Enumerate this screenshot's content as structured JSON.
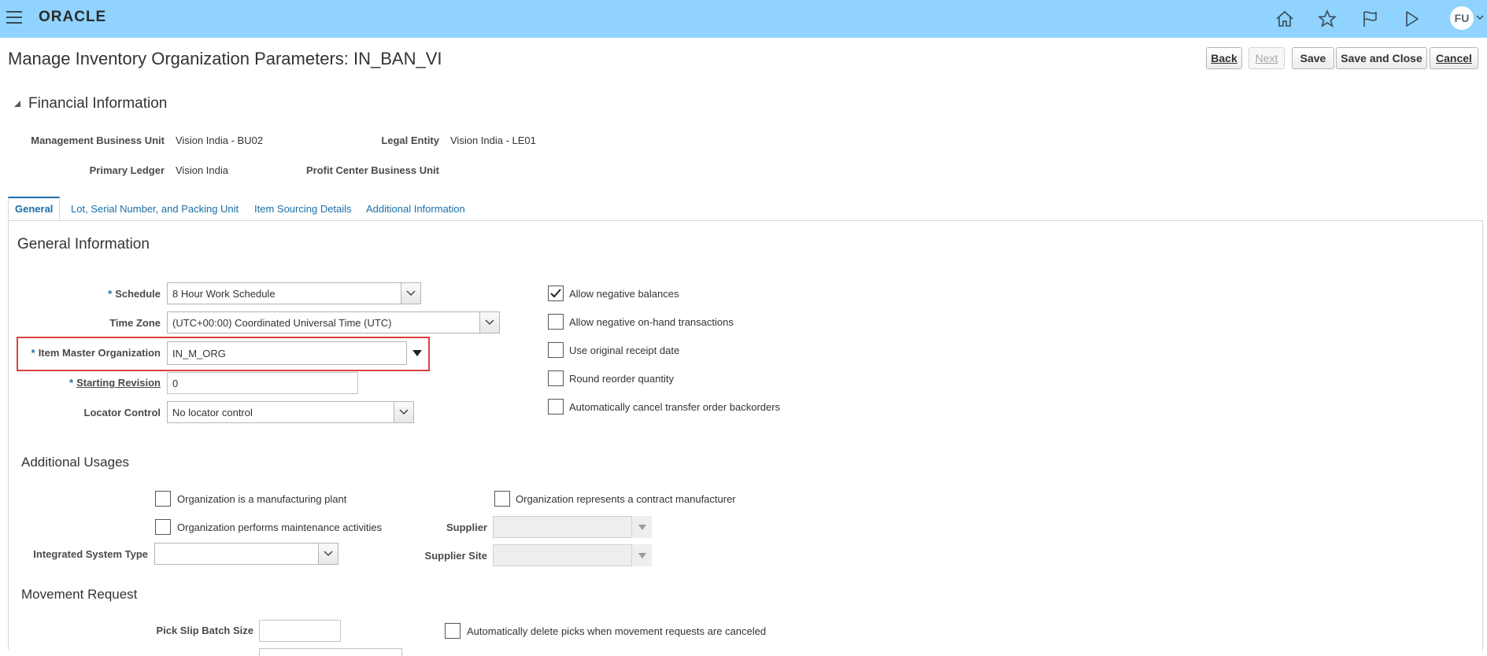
{
  "header": {
    "brand": "ORACLE",
    "avatar_initials": "FU",
    "icons": [
      "menu-icon",
      "home-icon",
      "star-icon",
      "flag-icon",
      "play-icon",
      "chevron-down-icon"
    ]
  },
  "page": {
    "title": "Manage Inventory Organization Parameters: IN_BAN_VI",
    "buttons": {
      "back": "Back",
      "next": "Next",
      "save": "Save",
      "save_close": "Save and Close",
      "cancel": "Cancel"
    }
  },
  "financial": {
    "title": "Financial Information",
    "mgmt_bu_label": "Management Business Unit",
    "mgmt_bu_value": "Vision India - BU02",
    "legal_entity_label": "Legal Entity",
    "legal_entity_value": "Vision India - LE01",
    "primary_ledger_label": "Primary Ledger",
    "primary_ledger_value": "Vision India",
    "profit_center_label": "Profit Center Business Unit"
  },
  "tabs": [
    {
      "label": "General",
      "active": true
    },
    {
      "label": "Lot, Serial Number, and Packing Unit",
      "active": false
    },
    {
      "label": "Item Sourcing Details",
      "active": false
    },
    {
      "label": "Additional Information",
      "active": false
    }
  ],
  "general": {
    "title": "General Information",
    "required_marker": "*",
    "schedule_label": "Schedule",
    "schedule_value": "8 Hour Work Schedule",
    "timezone_label": "Time Zone",
    "timezone_value": "(UTC+00:00) Coordinated Universal Time (UTC)",
    "item_master_label": "Item Master Organization",
    "item_master_value": "IN_M_ORG",
    "starting_revision_label": "Starting Revision",
    "starting_revision_value": "0",
    "locator_label": "Locator Control",
    "locator_value": "No locator control",
    "checkboxes": [
      {
        "label": "Allow negative balances",
        "checked": true
      },
      {
        "label": "Allow negative on-hand transactions",
        "checked": false
      },
      {
        "label": "Use original receipt date",
        "checked": false
      },
      {
        "label": "Round reorder quantity",
        "checked": false
      },
      {
        "label": "Automatically cancel transfer order backorders",
        "checked": false
      }
    ]
  },
  "additional": {
    "title": "Additional Usages",
    "manufacturing_plant": "Organization is a manufacturing plant",
    "contract_manufacturer": "Organization represents a contract manufacturer",
    "maintenance": "Organization performs maintenance activities",
    "supplier_label": "Supplier",
    "supplier_value": "",
    "integrated_label": "Integrated System Type",
    "integrated_value": "",
    "supplier_site_label": "Supplier Site",
    "supplier_site_value": ""
  },
  "movement": {
    "title": "Movement Request",
    "pick_slip_label": "Pick Slip Batch Size",
    "pick_slip_value": "",
    "auto_delete": "Automatically delete picks when movement requests are canceled"
  },
  "colors": {
    "header_bg": "#8fd3fe",
    "link": "#1a6fa8",
    "highlight": "#d9413d"
  }
}
